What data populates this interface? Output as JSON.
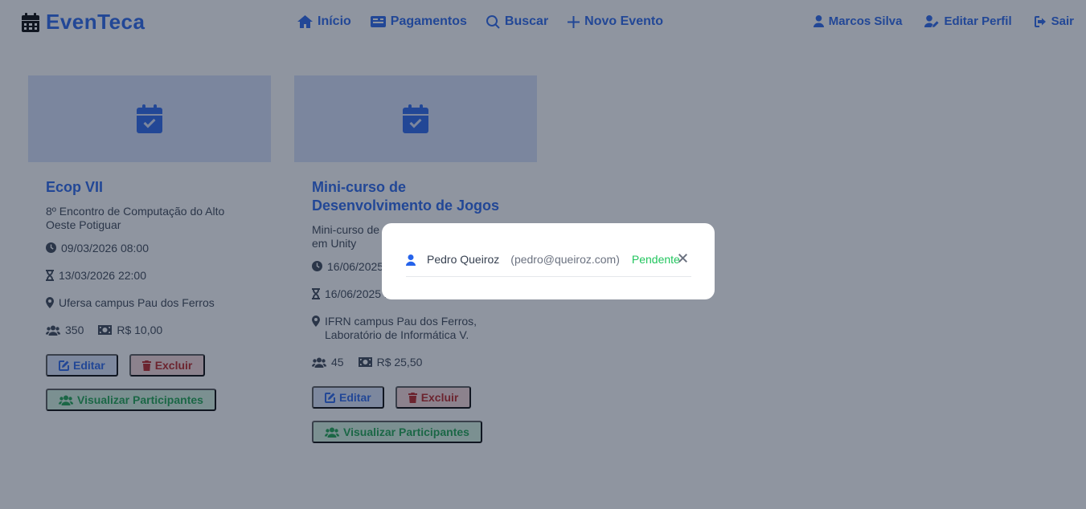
{
  "brand": {
    "name": "EvenTeca",
    "icon": "calendar-days-icon"
  },
  "nav": {
    "center": [
      {
        "label": "Início",
        "icon": "home-icon"
      },
      {
        "label": "Pagamentos",
        "icon": "money-check-icon"
      },
      {
        "label": "Buscar",
        "icon": "search-icon"
      },
      {
        "label": "Novo Evento",
        "icon": "plus-icon"
      }
    ],
    "right": [
      {
        "label": "Marcos Silva",
        "icon": "user-icon"
      },
      {
        "label": "Editar Perfil",
        "icon": "user-edit-icon"
      },
      {
        "label": "Sair",
        "icon": "sign-out-icon"
      }
    ]
  },
  "events": [
    {
      "title": "Ecop VII",
      "description": "8º Encontro de Computação do Alto Oeste Potiguar",
      "start": "09/03/2026 08:00",
      "end": "13/03/2026 22:00",
      "location": "Ufersa campus Pau dos Ferros",
      "capacity": "350",
      "price": "R$ 10,00"
    },
    {
      "title": "Mini-curso de Desenvolvimento de Jogos",
      "description": "Mini-curso de desenvolvimento de jogos em Unity",
      "start": "16/06/2025 07:00",
      "end": "16/06/2025 11:00",
      "location": "IFRN campus Pau dos Ferros, Laboratório de Informática V.",
      "capacity": "45",
      "price": "R$ 25,50"
    }
  ],
  "actions": {
    "edit": "Editar",
    "delete": "Excluir",
    "view_participants": "Visualizar Participantes"
  },
  "modal": {
    "participant": {
      "name": "Pedro Queiroz",
      "email": "(pedro@queiroz.com)",
      "status": "Pendente"
    },
    "close_icon": "close-icon"
  },
  "colors": {
    "accent": "#2563eb",
    "danger": "#b91c1c",
    "success": "#16a34a",
    "pending": "#22c55e"
  }
}
